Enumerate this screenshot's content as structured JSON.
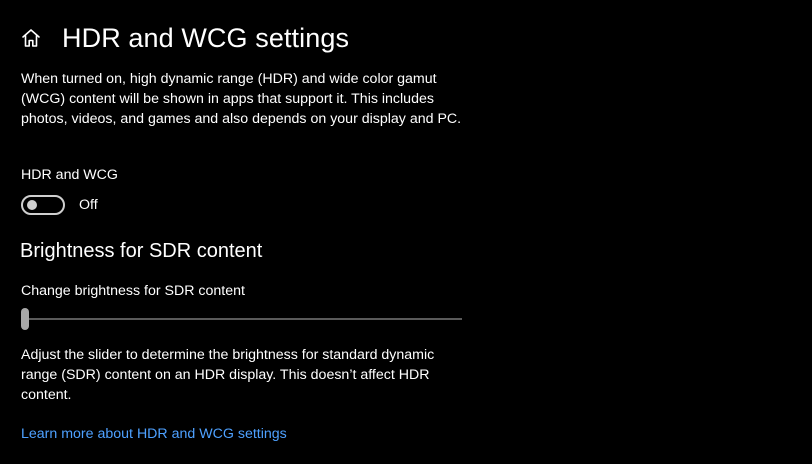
{
  "header": {
    "home_icon": "home-icon",
    "title": "HDR and WCG settings"
  },
  "intro_text": "When turned on, high dynamic range (HDR) and wide color gamut (WCG) content will be shown in apps that support it. This includes photos, videos, and games and also depends on your display and PC.",
  "hdr_toggle": {
    "label": "HDR and WCG",
    "state_text": "Off",
    "on": false
  },
  "sdr_section": {
    "title": "Brightness for SDR content",
    "slider_label": "Change brightness for SDR content",
    "slider_value": 0,
    "description": "Adjust the slider to determine the brightness for standard dynamic range (SDR) content on an HDR display. This doesn’t affect HDR content."
  },
  "learn_more_link": "Learn more about HDR and WCG settings",
  "colors": {
    "background": "#000000",
    "text": "#ffffff",
    "link": "#4ea1ff",
    "toggle_off": "#cfcfcf",
    "slider_track": "#5a5a5a"
  }
}
